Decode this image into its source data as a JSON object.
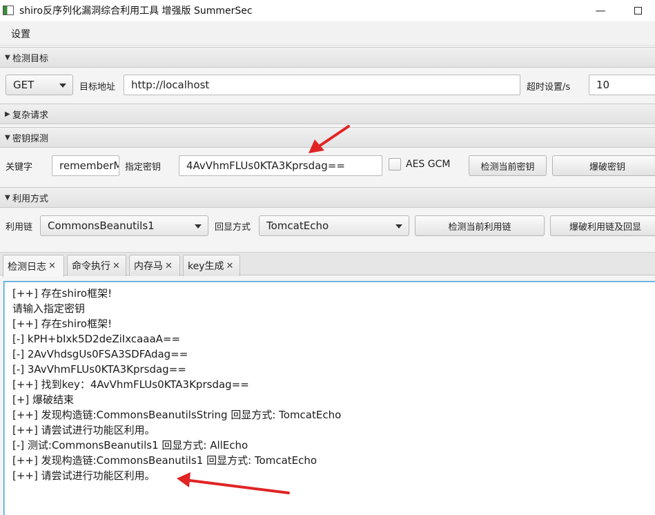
{
  "window": {
    "title": "shiro反序列化漏洞综合利用工具 增强版 SummerSec",
    "minimize_glyph": "—"
  },
  "menu": {
    "settings": "设置"
  },
  "sections": {
    "target": {
      "title": "检测目标"
    },
    "complex": {
      "title": "复杂请求"
    },
    "key": {
      "title": "密钥探测"
    },
    "exploit": {
      "title": "利用方式"
    }
  },
  "target": {
    "method": "GET",
    "url_label": "目标地址",
    "url_value": "http://localhost",
    "timeout_label": "超时设置/s",
    "timeout_value": "10"
  },
  "key": {
    "keyword_label": "关键字",
    "keyword_value": "rememberMe",
    "specified_key_label": "指定密钥",
    "specified_key_value": "4AvVhmFLUs0KTA3Kprsdag==",
    "aes_gcm_label": "AES GCM",
    "aes_gcm_checked": false,
    "check_current_key_btn": "检测当前密钥",
    "brute_key_btn": "爆破密钥"
  },
  "exploit": {
    "chain_label": "利用链",
    "chain_value": "CommonsBeanutils1",
    "echo_label": "回显方式",
    "echo_value": "TomcatEcho",
    "check_chain_btn": "检测当前利用链",
    "brute_chain_btn": "爆破利用链及回显"
  },
  "tabs": [
    {
      "label": "检测日志",
      "active": true
    },
    {
      "label": "命令执行",
      "active": false
    },
    {
      "label": "内存马",
      "active": false
    },
    {
      "label": "key生成",
      "active": false
    }
  ],
  "log_lines": [
    "[++] 存在shiro框架!",
    "请输入指定密钥",
    "[++] 存在shiro框架!",
    "[-] kPH+bIxk5D2deZiIxcaaaA==",
    "[-] 2AvVhdsgUs0FSA3SDFAdag==",
    "[-] 3AvVhmFLUs0KTA3Kprsdag==",
    "[++] 找到key：4AvVhmFLUs0KTA3Kprsdag==",
    "[+] 爆破结束",
    "[++] 发现构造链:CommonsBeanutilsString  回显方式: TomcatEcho",
    "[++] 请尝试进行功能区利用。",
    "[-] 测试:CommonsBeanutils1  回显方式: AllEcho",
    "[++] 发现构造链:CommonsBeanutils1  回显方式: TomcatEcho",
    "[++] 请尝试进行功能区利用。"
  ],
  "colors": {
    "annotation": "#e02424",
    "focus": "#3b9fd9"
  }
}
